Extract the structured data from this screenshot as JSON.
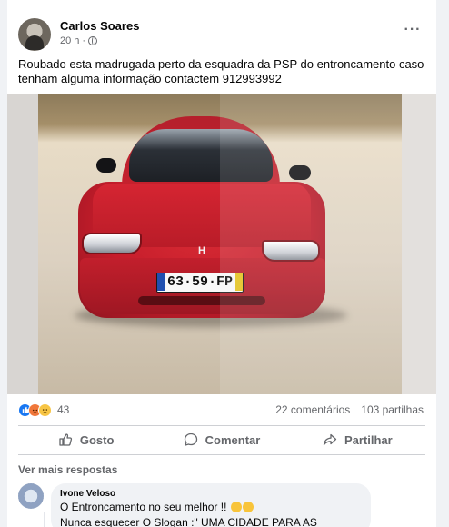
{
  "post": {
    "author": "Carlos Soares",
    "time": "20 h",
    "time_separator": "·",
    "more_label": "···",
    "text": "Roubado esta madrugada perto da esquadra da PSP do entroncamento caso tenham alguma informação contactem 912993992"
  },
  "photo": {
    "plate_text": "63·59·FP",
    "badge_letter": "H"
  },
  "reactions": {
    "count": "43",
    "icons": [
      "like-icon",
      "angry-icon",
      "sad-icon"
    ],
    "comments_label": "22 comentários",
    "shares_label": "103 partilhas"
  },
  "actions": {
    "like_label": "Gosto",
    "comment_label": "Comentar",
    "share_label": "Partilhar"
  },
  "comments": {
    "more_replies_label": "Ver mais respostas",
    "items": [
      {
        "author": "Ivone Veloso",
        "line1": "O Entroncamento no seu melhor !!",
        "line2": "Nunca esquecer O Slogan :\" UMA CIDADE PARA AS PESSOAS \"."
      }
    ]
  },
  "colors": {
    "brand_blue": "#1877f2",
    "secondary_text": "#65676b",
    "divider": "#ced0d4",
    "bubble_bg": "#f0f2f5"
  }
}
